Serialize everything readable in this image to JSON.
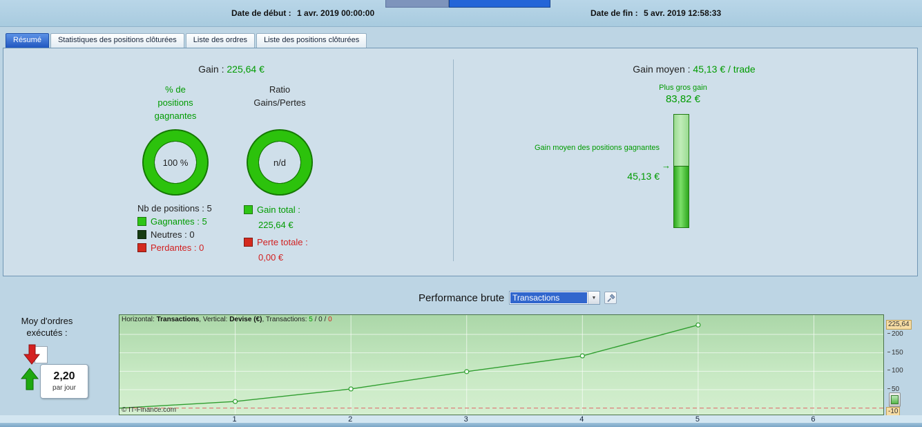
{
  "header": {
    "date_start_label": "Date de début :",
    "date_start_value": "1 avr. 2019 00:00:00",
    "date_end_label": "Date de fin :",
    "date_end_value": "5 avr. 2019 12:58:33"
  },
  "tabs": [
    {
      "label": "Résumé",
      "active": true
    },
    {
      "label": "Statistiques des positions clôturées",
      "active": false
    },
    {
      "label": "Liste des ordres",
      "active": false
    },
    {
      "label": "Liste des positions clôturées",
      "active": false
    }
  ],
  "summary": {
    "gain_label": "Gain :",
    "gain_value": "225,64 €",
    "pct_positions_label": "% de positions gagnantes",
    "pct_positions_value": "100 %",
    "ratio_label": "Ratio Gains/Pertes",
    "ratio_value": "n/d",
    "nb_positions": "Nb de positions : 5",
    "legend_win_label": "Gagnantes : 5",
    "legend_neutral_label": "Neutres : 0",
    "legend_loss_label": "Perdantes : 0",
    "gain_total_label": "Gain total :",
    "gain_total_value": "225,64 €",
    "loss_total_label": "Perte totale :",
    "loss_total_value": "0,00 €"
  },
  "right": {
    "gain_moyen_label": "Gain moyen :",
    "gain_moyen_value": "45,13 € / trade",
    "biggest_gain_label": "Plus gros gain",
    "biggest_gain_value": "83,82 €",
    "avg_win_label": "Gain moyen des positions gagnantes",
    "avg_win_value": "45,13 €"
  },
  "icons": {
    "dropdown_arrow": "▼",
    "avg_marker_arrow": "→"
  },
  "performance": {
    "title": "Performance brute",
    "select_value": "Transactions",
    "avg_orders_label": "Moy d'ordres exécutés :",
    "avg_orders_value": "2,20",
    "avg_orders_unit": "par jour",
    "copyright": "© IT-Finance.com"
  },
  "chart_data": {
    "type": "line",
    "title": "Performance brute — Transactions",
    "header": {
      "h_label": "Horizontal: ",
      "h_value": "Transactions",
      "sep1": ", Vertical: ",
      "v_value": "Devise (€)",
      "sep2": ", Transactions: ",
      "wins": "5",
      "slash1": " / ",
      "neutrals": "0",
      "slash2": " / ",
      "losses": "0"
    },
    "x": [
      0,
      1,
      2,
      3,
      4,
      5
    ],
    "y": [
      0,
      18,
      52,
      99,
      141.82,
      225.64
    ],
    "marker_from_index": 1,
    "x_ticks": [
      1,
      2,
      3,
      4,
      5,
      6
    ],
    "y_ticks": [
      50,
      100,
      150,
      200
    ],
    "xlim": [
      0,
      6.6
    ],
    "ylim": [
      -17.5,
      252.5
    ],
    "zero_line": 0,
    "ylabel_top": "225,64",
    "ylabel_bottom": "-10",
    "xlabel": "Transactions",
    "ylabel": "Devise (€)",
    "grid": true,
    "legend_position": "none",
    "line_color": "#2f9e2f"
  },
  "colors": {
    "green": "#009b00",
    "red": "#d21f1f",
    "accent_blue": "#2e6cd6",
    "donut_green": "#2cc20c",
    "chart_bg_green": "#c6e8c2",
    "axis_box_tan": "#f6dca4"
  }
}
